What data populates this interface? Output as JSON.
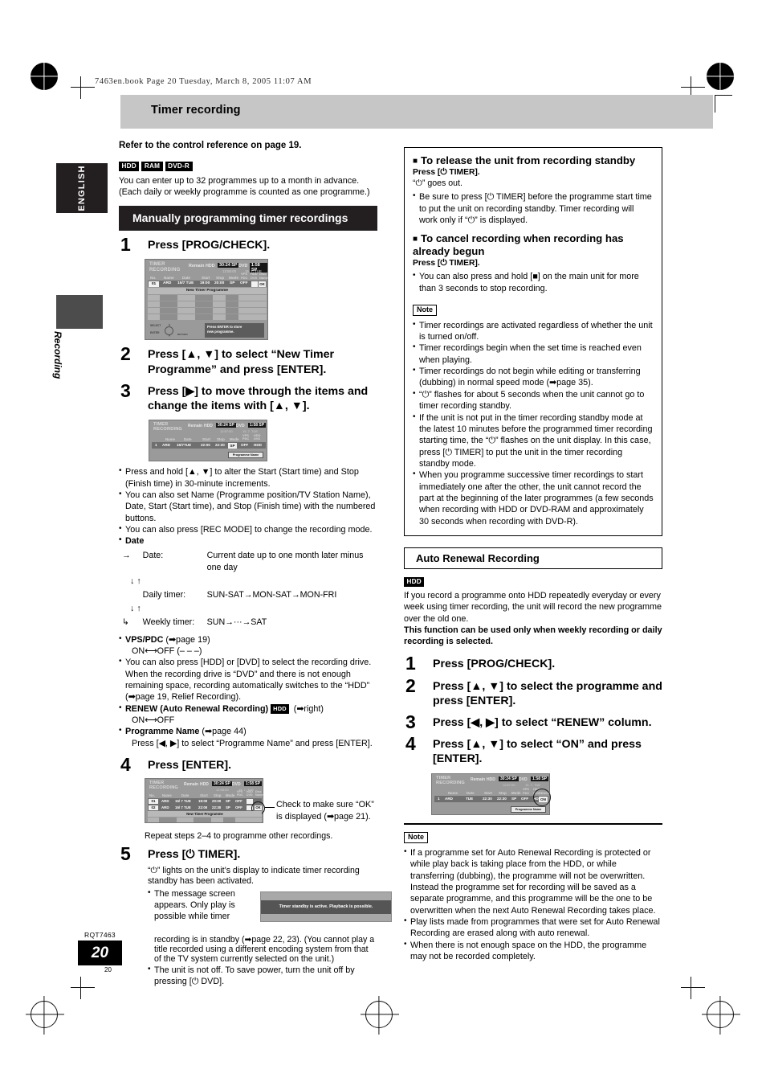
{
  "header": {
    "file_line": "7463en.book  Page 20  Tuesday, March 8, 2005  11:07 AM",
    "section_title": "Timer recording"
  },
  "side": {
    "language_tab": "ENGLISH",
    "section_label": "Recording"
  },
  "footer": {
    "rqt_code": "RQT7463",
    "page_number": "20",
    "page_number_small": "20"
  },
  "left": {
    "refer_line": "Refer to the control reference on page 19.",
    "media_chips": [
      "HDD",
      "RAM",
      "DVD-R"
    ],
    "intro_line1": "You can enter up to 32 programmes up to a month in advance.",
    "intro_line2": "(Each daily or weekly programme is counted as one programme.)",
    "section_heading": "Manually programming timer recordings",
    "steps": {
      "s1": {
        "num": "1",
        "text": "Press [PROG/CHECK]."
      },
      "s2": {
        "num": "2",
        "text": "Press [▲, ▼] to select “New Timer Programme” and press [ENTER]."
      },
      "s3": {
        "num": "3",
        "text": "Press [▶] to move through the items and change the items with [▲, ▼]."
      },
      "s4": {
        "num": "4",
        "text": "Press [ENTER]."
      },
      "s5": {
        "num": "5",
        "text": "Press [⏻ TIMER]."
      }
    },
    "step3_bullets": [
      "Press and hold [▲, ▼] to alter the Start (Start time) and Stop (Finish time) in 30-minute increments.",
      "You can also set Name (Programme position/TV Station Name), Date, Start (Start time), and Stop (Finish time) with the numbered buttons.",
      "You can also press [REC MODE] to change the recording mode."
    ],
    "date_label": "Date",
    "date_rows": [
      {
        "label": "Date:",
        "value": "Current date up to one month later minus one day"
      },
      {
        "label": "Daily timer:",
        "value": "SUN-SAT→MON-SAT→MON-FRI"
      },
      {
        "label": "Weekly timer:",
        "value": "SUN→···→SAT"
      }
    ],
    "vps_label": "VPS/PDC",
    "vps_ref": "(➡page 19)",
    "vps_values": "ON⟷OFF (– – –)",
    "drive_bullet_1": "You can also press [HDD] or [DVD] to select the recording drive.",
    "drive_bullet_2": "When the recording drive is “DVD” and there is not enough remaining space, recording automatically switches to the “HDD” (➡page 19, Relief Recording).",
    "renew_label": "RENEW (Auto Renewal Recording)",
    "renew_chip": "HDD",
    "renew_ref": "(➡right)",
    "renew_values": "ON⟷OFF",
    "progname_label": "Programme Name",
    "progname_ref": "(➡page 44)",
    "progname_text": "Press [◀, ▶] to select “Programme Name” and press [ENTER].",
    "step4_callout_line1": "Check to make sure “OK”",
    "step4_callout_line2": "is displayed (➡page 21).",
    "repeat_line": "Repeat steps 2–4 to programme other recordings.",
    "step5_text_1": "“⏻” lights on the unit’s display to indicate timer recording standby has been activated.",
    "step5_bullet_1a": "The message screen appears. Only play is possible while timer",
    "step5_bullet_1b": "recording is in standby (➡page 22, 23). (You cannot play a title recorded using a different encoding system from that of the TV system currently selected on the unit.)",
    "step5_bullet_2": "The unit is not off. To save power, turn the unit off by pressing [⏻ DVD].",
    "message_screen_text": "Timer standby is active. Playback is possible."
  },
  "right": {
    "release_heading": "To release the unit from recording standby",
    "release_press": "Press [⏻ TIMER].",
    "release_line": "“⏻” goes out.",
    "release_bullet": "Be sure to press [⏻ TIMER] before the programme start time to put the unit on recording standby. Timer recording will work only if “⏻” is displayed.",
    "cancel_heading": "To cancel recording when recording has already begun",
    "cancel_press": "Press [⏻ TIMER].",
    "cancel_bullet": "You can also press and hold [■] on the main unit for more than 3 seconds to stop recording.",
    "note_tag": "Note",
    "notes": [
      "Timer recordings are activated regardless of whether the unit is turned on/off.",
      "Timer recordings begin when the set time is reached even when playing.",
      "Timer recordings do not begin while editing or transferring (dubbing) in normal speed mode (➡page 35).",
      "“⏻” flashes for about 5 seconds when the unit cannot go to timer recording standby.",
      "If the unit is not put in the timer recording standby mode at the latest 10 minutes before the programmed timer recording starting time, the “⏻” flashes on the unit display. In this case, press [⏻ TIMER] to put the unit in the timer recording standby mode.",
      "When you programme successive timer recordings to start immediately one after the other, the unit cannot record the part at the beginning of the later programmes (a few seconds when recording with HDD or DVD-RAM and approximately 30 seconds when recording with DVD-R)."
    ],
    "auto_renewal_heading": "Auto Renewal Recording",
    "auto_renewal_chip": "HDD",
    "auto_renewal_text": "If you record a programme onto HDD repeatedly everyday or every week using timer recording, the unit will record the new programme over the old one.",
    "auto_renewal_bold": "This function can be used only when weekly recording or daily recording is selected.",
    "steps": {
      "s1": {
        "num": "1",
        "text": "Press [PROG/CHECK]."
      },
      "s2": {
        "num": "2",
        "text": "Press [▲, ▼] to select the programme and press [ENTER]."
      },
      "s3": {
        "num": "3",
        "text": "Press [◀, ▶] to select “RENEW” column."
      },
      "s4": {
        "num": "4",
        "text": "Press [▲, ▼] to select “ON” and press [ENTER]."
      }
    },
    "note_tag_2": "Note",
    "notes2": [
      "If a programme set for Auto Renewal Recording is protected or while play back is taking place from the HDD, or while transferring (dubbing), the programme will not be overwritten. Instead the programme set for recording will be saved as a separate programme, and this programme will be the one to be overwritten when the next Auto Renewal Recording takes place.",
      "Play lists made from programmes that were set for Auto Renewal Recording are erased along with auto renewal.",
      "When there is not enough space on the HDD, the programme may not be recorded completely."
    ]
  },
  "tv_screens": {
    "screen1": {
      "title_line1": "TIMER",
      "title_line2": "RECORDING",
      "remain_label": "Remain",
      "hdd_label": "HDD",
      "hdd_value": "30:24 SP",
      "dvd_label": "DVD",
      "dvd_value": "1:58 SP",
      "clock": "12:56:00",
      "date": "15. 7. TUE",
      "columns": [
        "No.",
        "Name",
        "Date",
        "Start",
        "Stop",
        "Mode",
        "VPS PDC",
        "HDD DVD",
        "Disc Name"
      ],
      "row": {
        "no": "01",
        "name": "ARD",
        "date": "15/7 TUE",
        "start": "19:00",
        "stop": "20:00",
        "mode": "SP",
        "vps": "OFF",
        "drive": "",
        "status": "OK"
      },
      "new_timer_label": "New Timer Programme",
      "tip_line1": "Press ENTER to store",
      "tip_line2": "new programme.",
      "select_label": "SELECT",
      "enter_label": "ENTER",
      "return_label": "RETURN"
    },
    "screen2": {
      "title_line1": "TIMER",
      "title_line2": "RECORDING",
      "remain_label": "Remain",
      "hdd_label": "HDD",
      "hdd_value": "30:24 SP",
      "dvd_label": "DVD",
      "dvd_value": "1:58 SP",
      "clock": "12:57:00",
      "date": "15. 7. TUE",
      "columns": [
        "Name",
        "Date",
        "Start",
        "Stop",
        "Mode",
        "VPS PDC",
        "HDD DVD"
      ],
      "row": {
        "no": "1",
        "name": "ARD",
        "date": "15/7TUE",
        "start": "22:00",
        "stop": "22:30",
        "mode": "SP",
        "vps": "OFF",
        "drive": "HDD"
      },
      "pname_label": "Programme Name"
    },
    "screen3": {
      "title_line1": "TIMER",
      "title_line2": "RECORDING",
      "remain_label": "Remain",
      "hdd_label": "HDD",
      "hdd_value": "30:24 SP",
      "dvd_label": "DVD",
      "dvd_value": "1:58 SP",
      "clock": "12:58:00",
      "date": "15. 7. TUE",
      "columns": [
        "No.",
        "Name",
        "Date",
        "Start",
        "Stop",
        "Mode",
        "VPS PDC",
        "HDD DVD",
        "Disc Name"
      ],
      "rows": [
        {
          "no": "01",
          "name": "ARD",
          "date": "15/ 7 TUE",
          "start": "19:00",
          "stop": "20:00",
          "mode": "SP",
          "vps": "OFF",
          "status": ""
        },
        {
          "no": "02",
          "name": "ARD",
          "date": "15/ 7 TUE",
          "start": "22:00",
          "stop": "22:30",
          "mode": "SP",
          "vps": "OFF",
          "status": "OK"
        }
      ],
      "new_timer_label": "New Timer Programme"
    },
    "screen4": {
      "title_line1": "TIMER",
      "title_line2": "RECORDING",
      "remain_label": "Remain",
      "hdd_label": "HDD",
      "hdd_value": "30:24 SP",
      "dvd_label": "DVD",
      "dvd_value": "1:58 SP",
      "clock": "12:57:00",
      "date": "15. 7. TUE",
      "columns": [
        "Name",
        "Date",
        "Start",
        "Stop",
        "Mode",
        "VPS PDC",
        "HDD DVD",
        "RENEW"
      ],
      "row": {
        "no": "1",
        "name": "ARD",
        "date": "TUE",
        "start": "22:30",
        "stop": "22:30",
        "mode": "SP",
        "vps": "OFF",
        "drive": "HD",
        "renew": "ON"
      },
      "pname_label": "Programme Name"
    }
  }
}
